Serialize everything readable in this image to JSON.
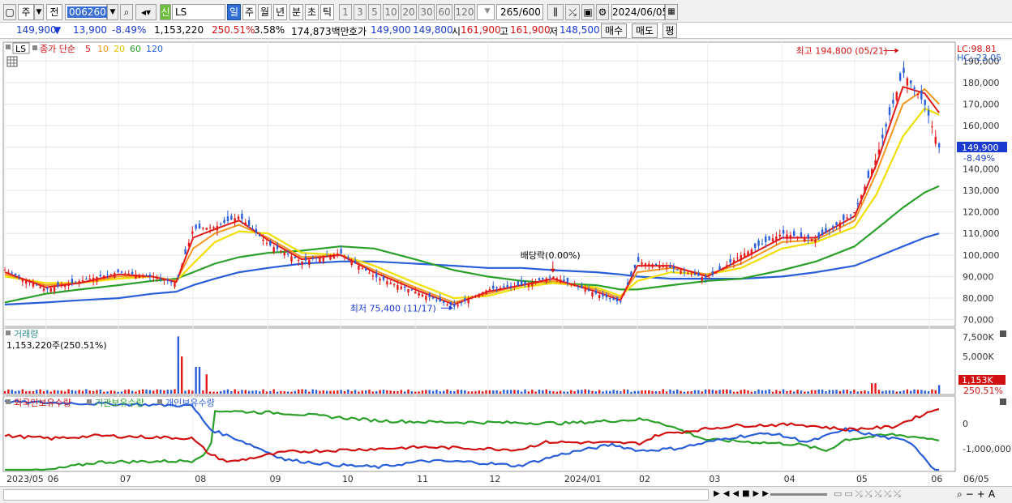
{
  "toolbar": {
    "mode1": "주",
    "mode2": "전",
    "code": "006260",
    "new_badge": "신",
    "name": "LS",
    "periods": [
      "일",
      "주",
      "월",
      "년",
      "분",
      "초",
      "틱"
    ],
    "minute_steps": [
      "1",
      "3",
      "5",
      "10",
      "20",
      "30",
      "60",
      "120"
    ],
    "count": "265",
    "count_total": "/600",
    "date": "2024/06/05"
  },
  "info": {
    "price": "149,900",
    "price_arrow": "▼",
    "change": "13,900",
    "change_pct": "-8.49%",
    "volume": "1,153,220",
    "volume_ratio": "250.51%",
    "turnover_pct": "3.58%",
    "amount": "174,873백만",
    "quote_label": "호가",
    "ask": "149,900",
    "bid": "149,800",
    "open_label": "시",
    "open": "161,900",
    "high_label": "고",
    "high": "161,900",
    "low_label": "저",
    "low": "148,500",
    "buy_btn": "매수",
    "sell_btn": "매도",
    "eval_btn": "평"
  },
  "chart_data": [
    {
      "type": "line",
      "panel": "price",
      "legend_name": "LS",
      "legend_label": "종가 단순",
      "ma_periods": [
        "5",
        "10",
        "20",
        "60",
        "120"
      ],
      "series_colors": {
        "5": "#e41a1a",
        "10": "#f5961e",
        "20": "#f0e000",
        "60": "#2aa02a",
        "120": "#2a5ed8"
      },
      "x_dates": [
        "2023/05/15",
        "2023/06/01",
        "2023/06/15",
        "2023/07/01",
        "2023/07/15",
        "2023/07/25",
        "2023/08/01",
        "2023/08/10",
        "2023/08/20",
        "2023/09/01",
        "2023/09/15",
        "2023/10/01",
        "2023/10/15",
        "2023/11/01",
        "2023/11/17",
        "2023/12/01",
        "2023/12/15",
        "2023/12/28",
        "2024/01/15",
        "2024/01/25",
        "2024/02/01",
        "2024/02/15",
        "2024/03/01",
        "2024/03/15",
        "2024/04/01",
        "2024/04/15",
        "2024/05/01",
        "2024/05/10",
        "2024/05/21",
        "2024/05/30",
        "2024/06/05"
      ],
      "close": [
        93000,
        84000,
        88000,
        92000,
        90000,
        87000,
        112000,
        113000,
        118000,
        105000,
        97000,
        101000,
        90000,
        83000,
        76000,
        84000,
        86000,
        90000,
        82000,
        78000,
        97000,
        94000,
        89000,
        100000,
        110000,
        107000,
        120000,
        145000,
        185000,
        170000,
        149900
      ],
      "ma5": [
        92000,
        85000,
        87000,
        91000,
        90000,
        87500,
        108000,
        112000,
        116000,
        107000,
        98000,
        100000,
        92000,
        84000,
        77000,
        83000,
        86000,
        89000,
        83000,
        79000,
        95000,
        95000,
        90000,
        98000,
        108000,
        108000,
        118000,
        142000,
        178000,
        175000,
        166000
      ],
      "ma10": [
        91000,
        86000,
        87000,
        90000,
        90000,
        88000,
        103000,
        110000,
        114000,
        108000,
        99000,
        100000,
        93000,
        85000,
        78000,
        82000,
        86000,
        88000,
        84000,
        80000,
        92000,
        94000,
        91000,
        96000,
        106000,
        107000,
        116000,
        138000,
        170000,
        177000,
        170000
      ],
      "ma20": [
        90000,
        87000,
        87000,
        89000,
        90000,
        88000,
        96000,
        106000,
        111000,
        110000,
        101000,
        100000,
        95000,
        87000,
        80000,
        81000,
        85000,
        87000,
        85000,
        81000,
        88000,
        92000,
        91000,
        94000,
        103000,
        106000,
        113000,
        128000,
        155000,
        168000,
        165000
      ],
      "ma60": [
        78000,
        82000,
        84000,
        86000,
        88000,
        89000,
        92000,
        96000,
        99000,
        101000,
        102000,
        104000,
        103000,
        98000,
        93000,
        90000,
        88000,
        87000,
        86000,
        84000,
        84000,
        86000,
        88000,
        89000,
        93000,
        97000,
        104000,
        112000,
        122000,
        129000,
        132000
      ],
      "ma120": [
        77000,
        78000,
        79000,
        80000,
        82000,
        83000,
        86000,
        89000,
        92000,
        94000,
        96000,
        97000,
        97000,
        96000,
        95000,
        94000,
        94000,
        93000,
        92000,
        91000,
        90000,
        89000,
        89000,
        89000,
        90000,
        92000,
        95000,
        99000,
        104000,
        108000,
        110000
      ],
      "ylim": [
        68000,
        198000
      ],
      "y_ticks": [
        "190,000",
        "180,000",
        "170,000",
        "160,000",
        "150,000",
        "140,000",
        "130,000",
        "120,000",
        "110,000",
        "100,000",
        "90,000",
        "80,000",
        "70,000"
      ],
      "y_tick_values": [
        190000,
        180000,
        170000,
        160000,
        150000,
        140000,
        130000,
        120000,
        110000,
        100000,
        90000,
        80000,
        70000
      ],
      "lc_label": "LC:98.81",
      "hc_label": "HC:-23.05",
      "last_price_label": "149,900",
      "last_change_label": "-8.49%",
      "annotations": {
        "high": "최고 194,800 (05/21)",
        "low": "최저 75,400 (11/17)",
        "dividend": "배당락(0.00%)"
      }
    },
    {
      "type": "bar",
      "panel": "volume",
      "legend_name": "거래량",
      "current_label": "1,153,220주(250.51%)",
      "y_ticks": [
        "7,500K",
        "5,000K",
        "2,500K"
      ],
      "last_label": "1,153K",
      "last_pct": "250.51%",
      "ylim_k": [
        0,
        8500
      ],
      "spikes_k": {
        "2023/07/26": 7700,
        "2023/07/27": 5000,
        "2023/08/03": 3600,
        "2023/08/07": 2600,
        "2024/05/09": 1400
      }
    },
    {
      "type": "line",
      "panel": "holdings",
      "series_names": [
        "외국인보유수량",
        "기관보유수량",
        "개인보유수량"
      ],
      "series_colors": [
        "#d01010",
        "#2aa02a",
        "#2a5ed8"
      ],
      "y_ticks": [
        "0",
        "-1,000,000"
      ],
      "y_tick_values": [
        0,
        -1000000
      ]
    }
  ],
  "x_axis_labels": [
    "2023/05",
    "06",
    "07",
    "08",
    "09",
    "10",
    "11",
    "12",
    "2024/01",
    "02",
    "03",
    "04",
    "05",
    "06",
    "06/05"
  ]
}
